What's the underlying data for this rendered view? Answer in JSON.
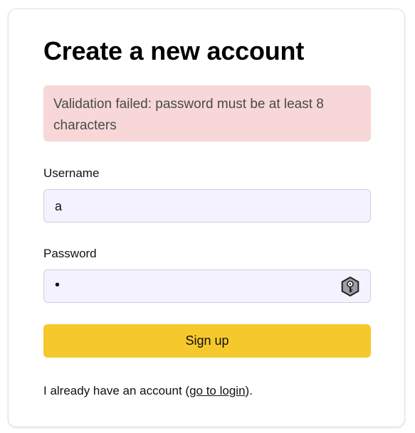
{
  "page": {
    "title": "Create a new account"
  },
  "alert": {
    "message": "Validation failed: password must be at least 8 characters",
    "background_color": "#f7d7d7"
  },
  "form": {
    "username_label": "Username",
    "username_value": "a",
    "password_label": "Password",
    "password_value_masked": "•",
    "password_manager_icon": "key-hexagon-icon",
    "field_background_color": "#f5f2ff",
    "submit_label": "Sign up",
    "submit_color": "#f5c92b"
  },
  "footer": {
    "prefix": "I already have an account (",
    "link_text": "go to login",
    "suffix": ")."
  }
}
